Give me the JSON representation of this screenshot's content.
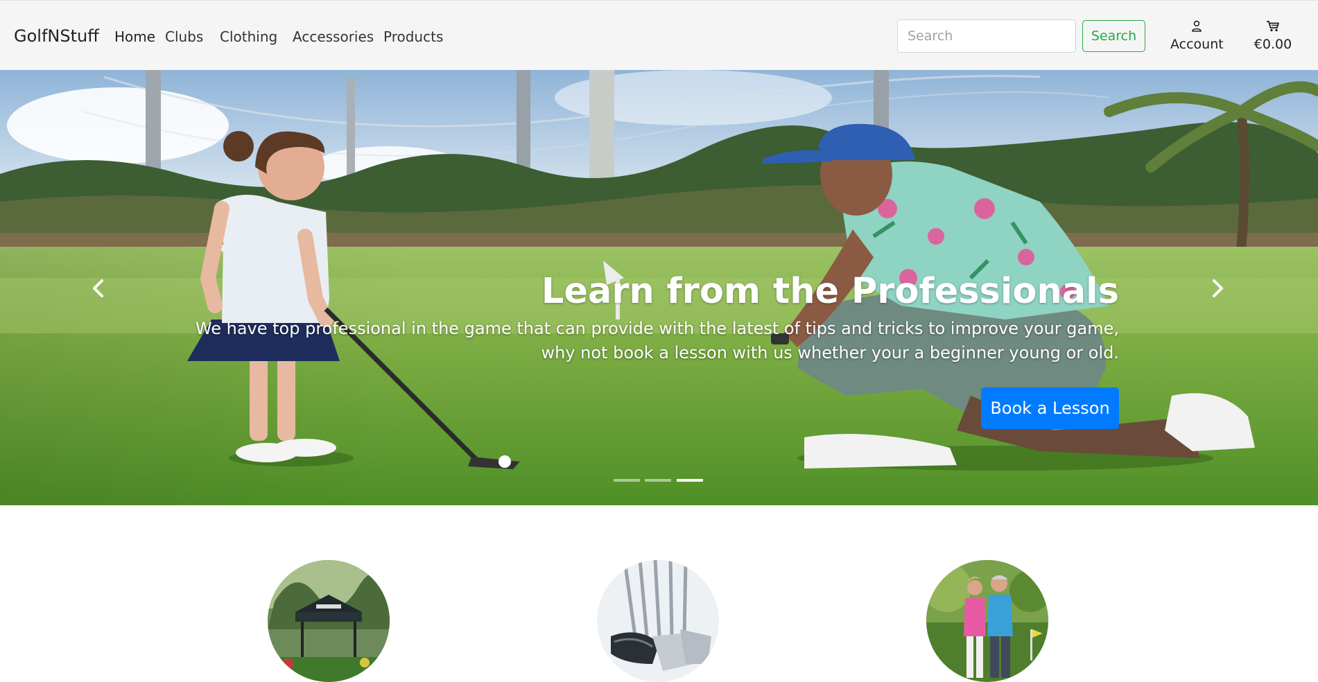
{
  "brand": "GolfNStuff",
  "nav": {
    "items": [
      {
        "label": "Home"
      },
      {
        "label": "Clubs"
      },
      {
        "label": "Clothing"
      },
      {
        "label": "Accessories"
      },
      {
        "label": "Products"
      }
    ]
  },
  "search": {
    "placeholder": "Search",
    "value": "",
    "button_label": "Search"
  },
  "account": {
    "label": "Account",
    "icon": "person-icon"
  },
  "cart": {
    "total": "€0.00",
    "icon": "cart-icon"
  },
  "carousel": {
    "slide_count": 3,
    "active_slide": 3,
    "title": "Learn from the Professionals",
    "text": "We have top professional in the game that can provide with the latest of tips and tricks to improve your game, why not book a lesson with us whether your a beginner young or old.",
    "button_label": "Book a Lesson"
  },
  "features": [
    {
      "image": "golf-tent-event-photo"
    },
    {
      "image": "golf-irons-photo"
    },
    {
      "image": "golf-couple-photo"
    }
  ],
  "colors": {
    "navbar_bg": "#f5f5f5",
    "search_green": "#28a745",
    "primary_blue": "#007bff"
  }
}
